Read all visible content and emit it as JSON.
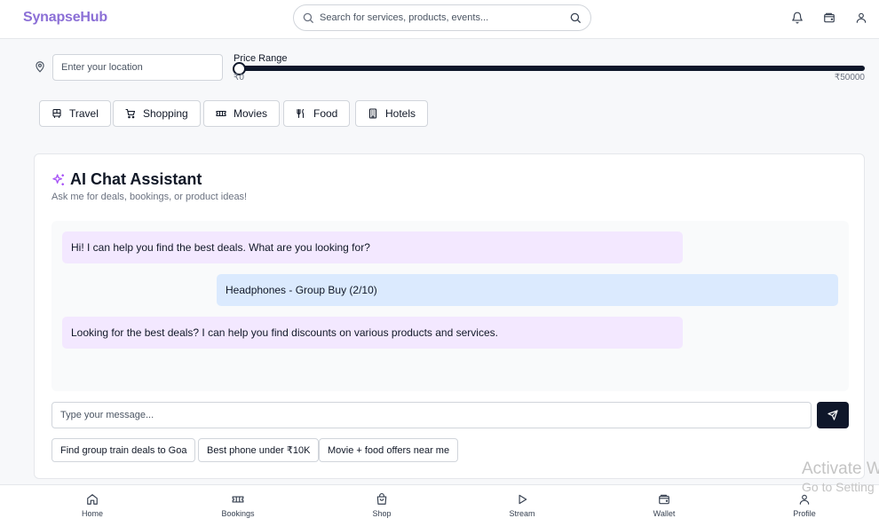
{
  "header": {
    "brand": "SynapseHub",
    "search_placeholder": "Search for services, products, events..."
  },
  "filters": {
    "location_placeholder": "Enter your location",
    "price_label": "Price Range",
    "price_min": "₹0",
    "price_max": "₹50000",
    "price_value_fraction": 0
  },
  "categories": [
    {
      "label": "Travel",
      "icon": "bus-icon"
    },
    {
      "label": "Shopping",
      "icon": "cart-icon"
    },
    {
      "label": "Movies",
      "icon": "ticket-icon"
    },
    {
      "label": "Food",
      "icon": "utensils-icon"
    },
    {
      "label": "Hotels",
      "icon": "building-icon"
    }
  ],
  "chat": {
    "title": "AI Chat Assistant",
    "subtitle": "Ask me for deals, bookings, or product ideas!",
    "messages": [
      {
        "role": "bot",
        "text": "Hi! I can help you find the best deals. What are you looking for?"
      },
      {
        "role": "user",
        "text": "Headphones - Group Buy (2/10)"
      },
      {
        "role": "bot",
        "text": "Looking for the best deals? I can help you find discounts on various products and services."
      }
    ],
    "input_placeholder": "Type your message...",
    "suggestions": [
      "Find group train deals to Goa",
      "Best phone under ₹10K",
      "Movie + food offers near me"
    ]
  },
  "bottom_nav": [
    {
      "label": "Home",
      "icon": "home-icon"
    },
    {
      "label": "Bookings",
      "icon": "ticket-icon"
    },
    {
      "label": "Shop",
      "icon": "bag-icon"
    },
    {
      "label": "Stream",
      "icon": "play-icon"
    },
    {
      "label": "Wallet",
      "icon": "wallet-icon"
    },
    {
      "label": "Profile",
      "icon": "user-icon"
    }
  ],
  "watermark": {
    "line1": "Activate W",
    "line2": "Go to Setting"
  },
  "colors": {
    "brand": "#8b6fd6",
    "bot_bubble": "#f3e8ff",
    "user_bubble": "#dbeafe",
    "primary_dark": "#0f172a"
  }
}
